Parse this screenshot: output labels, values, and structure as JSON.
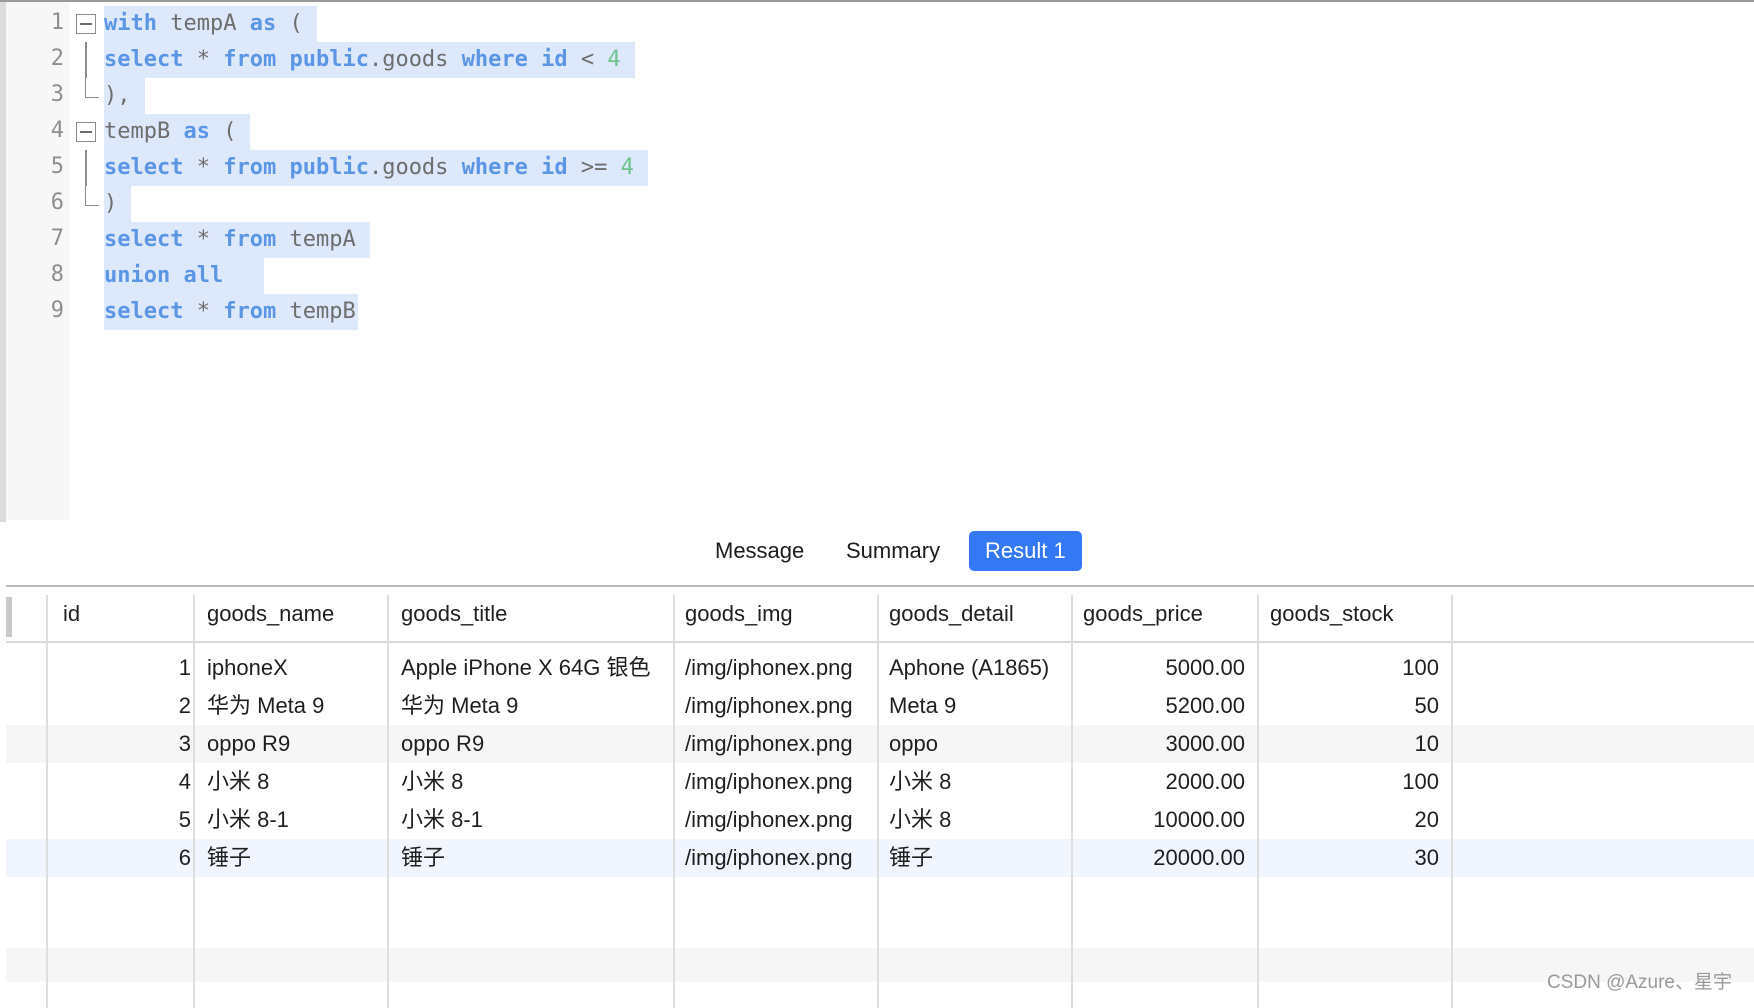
{
  "editor": {
    "lines": [
      {
        "num": "1"
      },
      {
        "num": "2"
      },
      {
        "num": "3"
      },
      {
        "num": "4"
      },
      {
        "num": "5"
      },
      {
        "num": "6"
      },
      {
        "num": "7"
      },
      {
        "num": "8"
      },
      {
        "num": "9"
      }
    ]
  },
  "tabs": [
    {
      "label": "Message"
    },
    {
      "label": "Summary"
    },
    {
      "label": "Result 1"
    }
  ],
  "grid": {
    "columns": [
      "id",
      "goods_name",
      "goods_title",
      "goods_img",
      "goods_detail",
      "goods_price",
      "goods_stock"
    ],
    "rows": [
      [
        "1",
        "iphoneX",
        "Apple iPhone X 64G 银色",
        "/img/iphonex.png",
        "Aphone (A1865)",
        "5000.00",
        "100"
      ],
      [
        "2",
        "华为 Meta 9",
        "华为 Meta 9",
        "/img/iphonex.png",
        "Meta 9",
        "5200.00",
        "50"
      ],
      [
        "3",
        "oppo R9",
        "oppo R9",
        "/img/iphonex.png",
        "oppo",
        "3000.00",
        "10"
      ],
      [
        "4",
        "小米 8",
        "小米 8",
        "/img/iphonex.png",
        "小米 8",
        "2000.00",
        "100"
      ],
      [
        "5",
        "小米 8-1",
        "小米 8-1",
        "/img/iphonex.png",
        "小米 8",
        "10000.00",
        "20"
      ],
      [
        "6",
        "锤子",
        "锤子",
        "/img/iphonex.png",
        "锤子",
        "20000.00",
        "30"
      ]
    ]
  },
  "watermark": "CSDN @Azure、星宇",
  "colors": {
    "accent": "#3478f6",
    "keyword": "#5b95e6",
    "number": "#6cc48a",
    "selection": "#dde8fb"
  }
}
